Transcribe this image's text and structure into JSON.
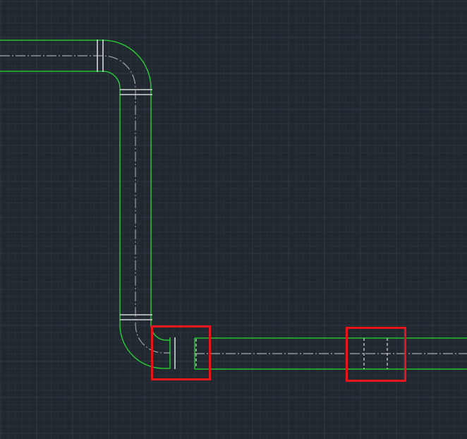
{
  "app": {
    "view": "cad-model-space",
    "background_color": "#212830"
  },
  "grid": {
    "visible": true,
    "minor_color": "#283039",
    "major_color": "#2f3843"
  },
  "drawing": {
    "pipe_outline_color": "#22dd33",
    "centerline_color": "#c8c8c8",
    "joint_line_color": "#d6d6d6",
    "hidden_line_color": "#cfcfcf",
    "highlight_color": "#e8141c",
    "entities": [
      "horizontal-pipe-top",
      "elbow-top-right",
      "vertical-pipe",
      "elbow-bottom-left",
      "horizontal-pipe-bottom"
    ],
    "highlights": [
      "elbow-end-flange-detail",
      "inline-joint-detail"
    ]
  }
}
